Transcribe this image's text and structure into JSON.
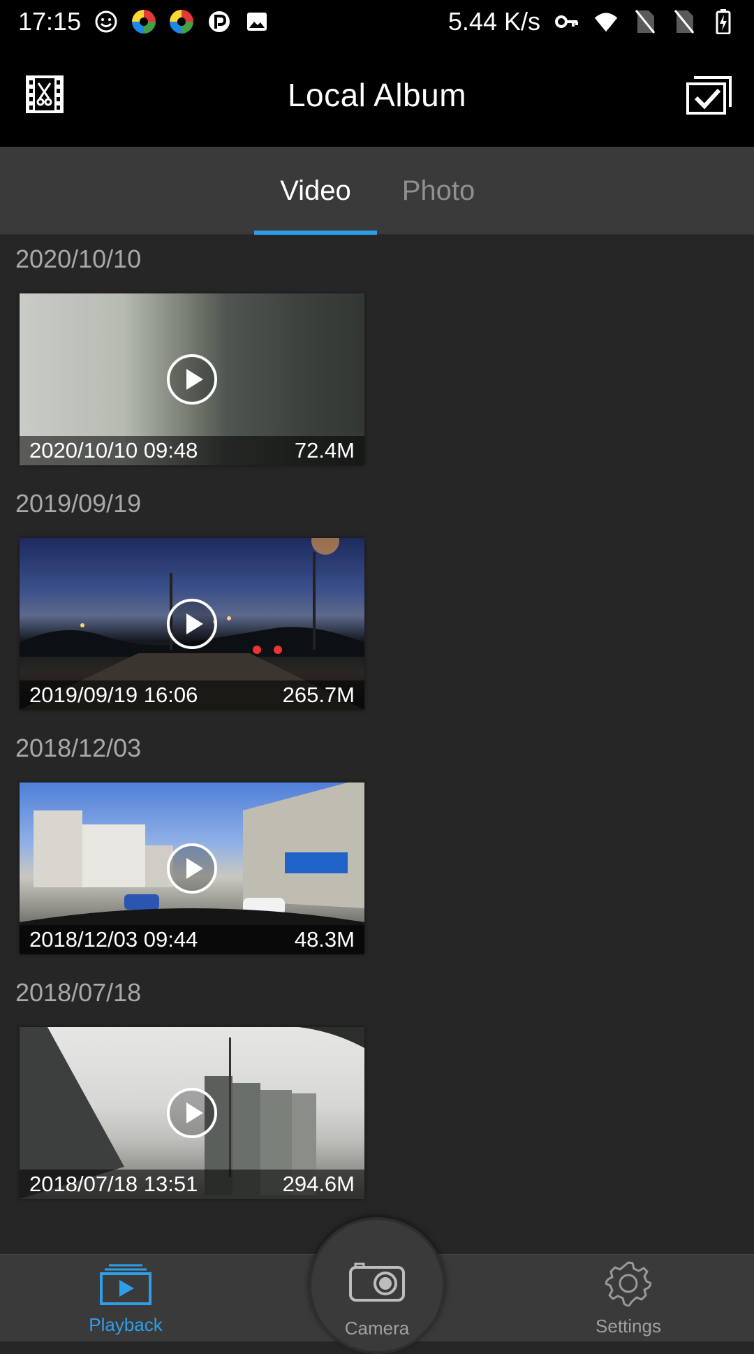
{
  "status_bar": {
    "time": "17:15",
    "speed": "5.44 K/s",
    "icons": [
      "smiley-icon",
      "pinwheel-icon",
      "pinwheel-icon",
      "p-badge-icon",
      "image-icon",
      "key-icon",
      "wifi-icon",
      "no-sim-icon",
      "no-sim-icon",
      "battery-charging-icon"
    ]
  },
  "app_bar": {
    "title": "Local Album",
    "left_icon": "video-edit-icon",
    "right_icon": "multi-select-icon"
  },
  "tabs": [
    {
      "label": "Video",
      "active": true
    },
    {
      "label": "Photo",
      "active": false
    }
  ],
  "colors": {
    "accent": "#2f9ee8",
    "background": "#262626",
    "bar": "#000000",
    "tab_bar": "#3a3a3a"
  },
  "groups": [
    {
      "date": "2020/10/10",
      "video": {
        "timestamp": "2020/10/10 09:48",
        "size": "72.4M",
        "scene": "dim-gray-cabin"
      }
    },
    {
      "date": "2019/09/19",
      "video": {
        "timestamp": "2019/09/19 16:06",
        "size": "265.7M",
        "scene": "dusk-street"
      }
    },
    {
      "date": "2018/12/03",
      "video": {
        "timestamp": "2018/12/03 09:44",
        "size": "48.3M",
        "scene": "daytime-street"
      }
    },
    {
      "date": "2018/07/18",
      "video": {
        "timestamp": "2018/07/18 13:51",
        "size": "294.6M",
        "scene": "foggy-highrise"
      }
    }
  ],
  "bottom_nav": {
    "playback": {
      "label": "Playback",
      "icon": "playback-icon",
      "active": true
    },
    "camera": {
      "label": "Camera",
      "icon": "camera-icon"
    },
    "settings": {
      "label": "Settings",
      "icon": "gear-icon"
    }
  }
}
